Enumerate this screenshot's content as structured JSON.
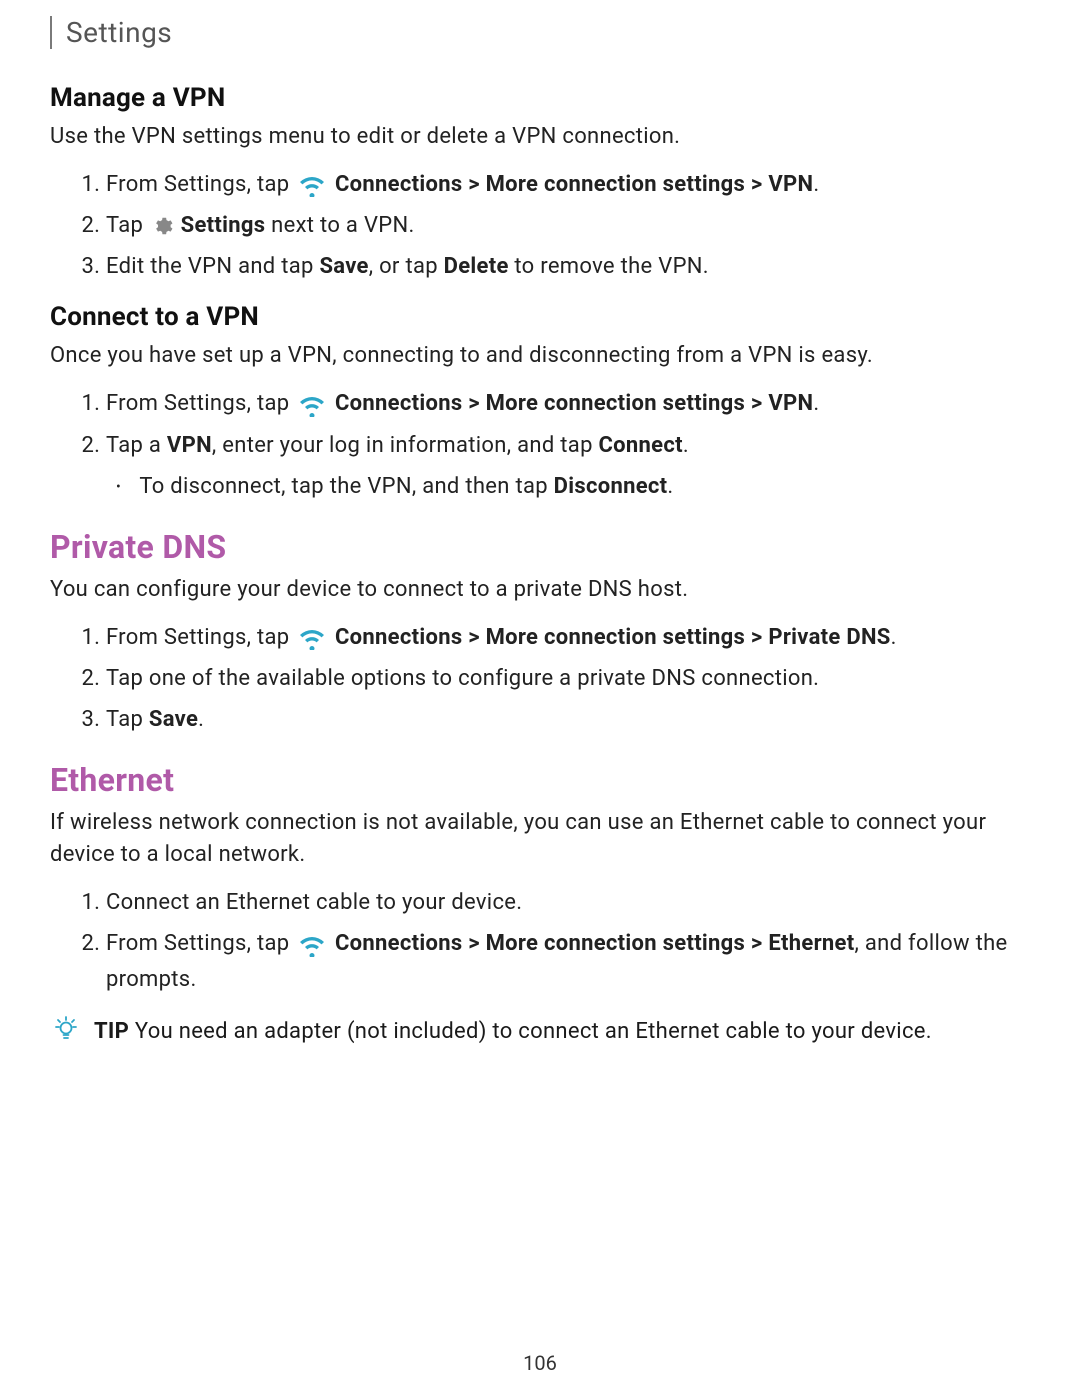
{
  "header": {
    "title": "Settings"
  },
  "sections": {
    "manageVpn": {
      "heading": "Manage a VPN",
      "intro": "Use the VPN settings menu to edit or delete a VPN connection.",
      "step1_prefix": "From Settings, tap ",
      "step1_path": "Connections > More connection settings > VPN",
      "step1_suffix": ".",
      "step2_prefix": "Tap ",
      "step2_bold": "Settings",
      "step2_suffix": " next to a VPN.",
      "step3_a": "Edit the VPN and tap ",
      "step3_b1": "Save",
      "step3_c": ", or tap ",
      "step3_b2": "Delete",
      "step3_d": " to remove the VPN."
    },
    "connectVpn": {
      "heading": "Connect to a VPN",
      "intro": "Once you have set up a VPN, connecting to and disconnecting from a VPN is easy.",
      "step1_prefix": "From Settings, tap ",
      "step1_path": "Connections > More connection settings > VPN",
      "step1_suffix": ".",
      "step2_a": "Tap a ",
      "step2_b1": "VPN",
      "step2_c": ", enter your log in information, and tap ",
      "step2_b2": "Connect",
      "step2_d": ".",
      "bullet_a": "To disconnect, tap the VPN, and then tap ",
      "bullet_b": "Disconnect",
      "bullet_c": "."
    },
    "privateDns": {
      "heading": "Private DNS",
      "intro": "You can configure your device to connect to a private DNS host.",
      "step1_prefix": "From Settings, tap ",
      "step1_path": "Connections > More connection settings > Private DNS",
      "step1_suffix": ".",
      "step2": "Tap one of the available options to configure a private DNS connection.",
      "step3_a": "Tap ",
      "step3_b": "Save",
      "step3_c": "."
    },
    "ethernet": {
      "heading": "Ethernet",
      "intro": "If wireless network connection is not available, you can use an Ethernet cable to connect your device to a local network.",
      "step1": "Connect an Ethernet cable to your device.",
      "step2_prefix": "From Settings, tap ",
      "step2_path": "Connections > More connection settings > Ethernet",
      "step2_suffix": ", and follow the prompts.",
      "tip_label": "TIP",
      "tip_text": "  You need an adapter (not included) to connect an Ethernet cable to your device."
    }
  },
  "pageNumber": "106",
  "colors": {
    "accent": "#b05aa8",
    "wifi": "#2ca6c8",
    "gear": "#888888",
    "tip": "#2ca6c8"
  }
}
